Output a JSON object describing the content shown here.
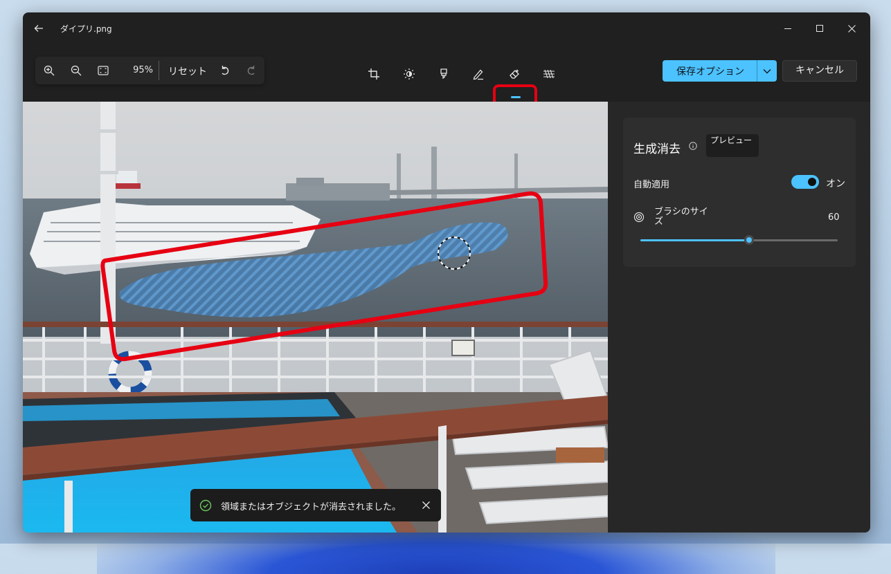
{
  "window": {
    "title": "ダイプリ.png"
  },
  "toolbar": {
    "zoom_percent": "95%",
    "reset_label": "リセット",
    "tools": [
      {
        "icon": "crop-icon"
      },
      {
        "icon": "brightness-icon"
      },
      {
        "icon": "markup-icon"
      },
      {
        "icon": "draw-icon"
      },
      {
        "icon": "eraser-icon",
        "selected": true
      },
      {
        "icon": "filter-icon"
      }
    ],
    "save_label": "保存オプション",
    "cancel_label": "キャンセル"
  },
  "panel": {
    "title": "生成消去",
    "preview_badge": "プレビュー",
    "auto_apply_label": "自動適用",
    "auto_apply_state": "オン",
    "auto_apply_on": true,
    "brush_size_label": "ブラシのサイズ",
    "brush_size_value": "60",
    "brush_slider_fraction": 0.55
  },
  "toast": {
    "message": "領域またはオブジェクトが消去されました。"
  },
  "colors": {
    "accent": "#4cc2ff",
    "highlight": "#e60012",
    "window_bg": "#202020",
    "panel_bg": "#272727"
  }
}
